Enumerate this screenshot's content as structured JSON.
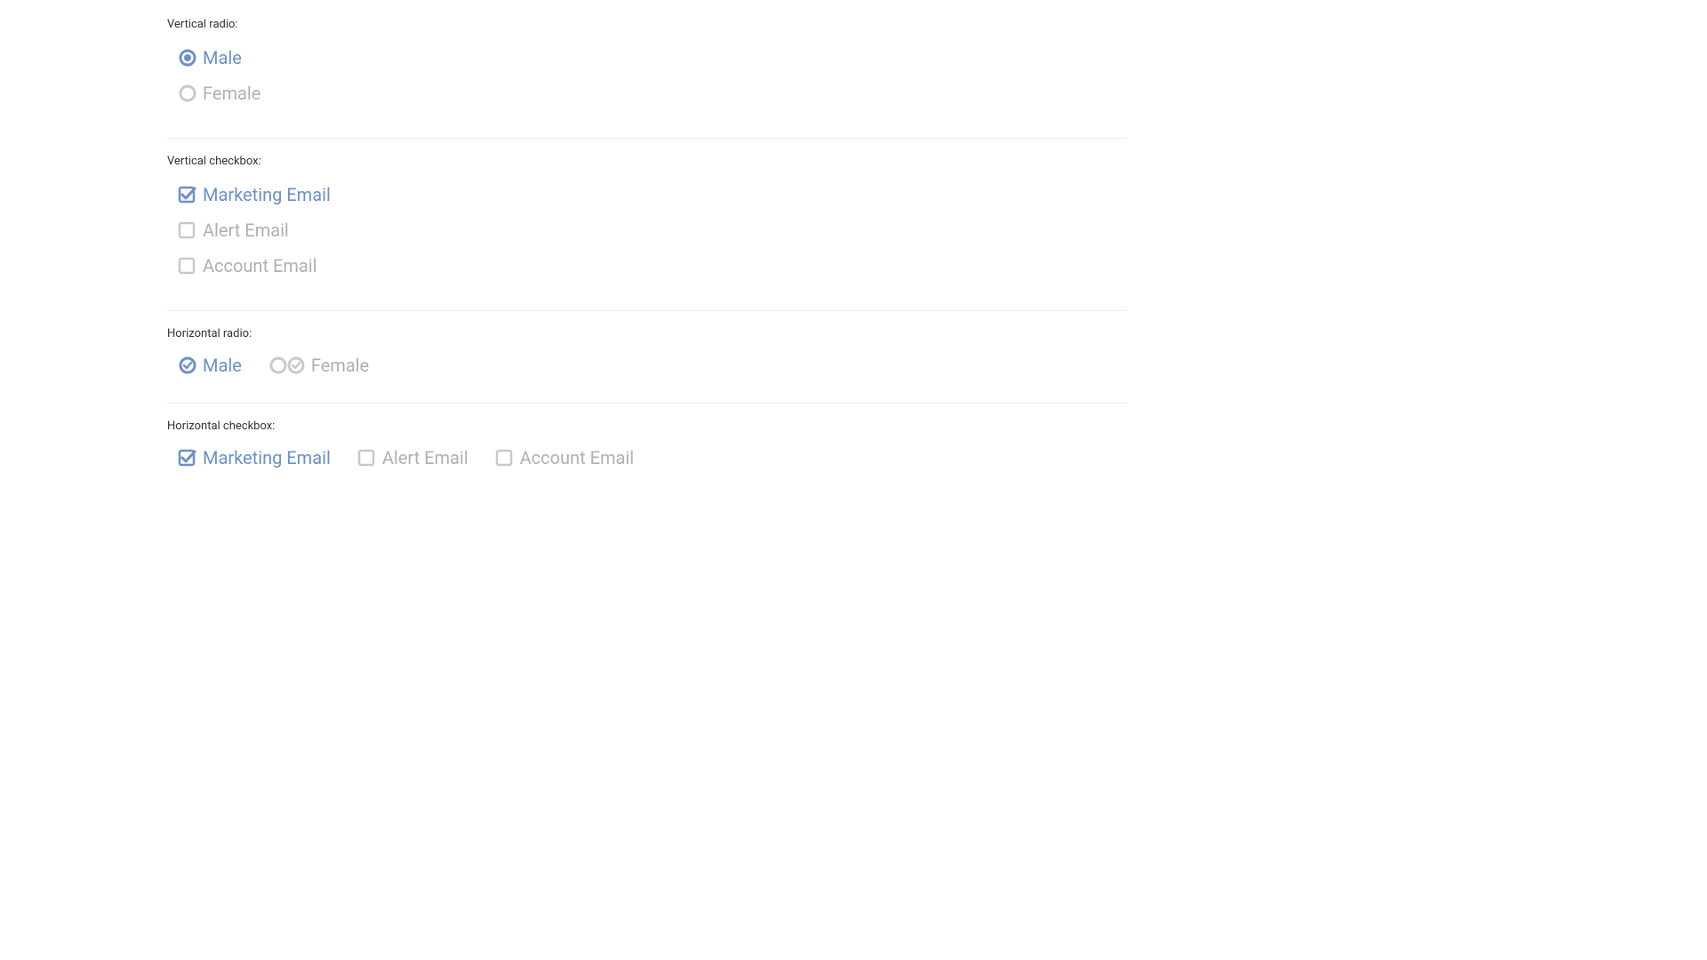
{
  "colors": {
    "selected": "#6b8fc9",
    "unselected": "#c9c9c9"
  },
  "sections": {
    "vertical_radio": {
      "label": "Vertical radio:",
      "options": [
        {
          "label": "Male",
          "selected": true
        },
        {
          "label": "Female",
          "selected": false
        }
      ]
    },
    "vertical_checkbox": {
      "label": "Vertical checkbox:",
      "options": [
        {
          "label": "Marketing Email",
          "selected": true
        },
        {
          "label": "Alert Email",
          "selected": false
        },
        {
          "label": "Account Email",
          "selected": false
        }
      ]
    },
    "horizontal_radio": {
      "label": "Horizontal radio:",
      "options": [
        {
          "label": "Male",
          "selected": true
        },
        {
          "label": "Female",
          "selected": false,
          "double_icon": true
        }
      ]
    },
    "horizontal_checkbox": {
      "label": "Horizontal checkbox:",
      "options": [
        {
          "label": "Marketing Email",
          "selected": true
        },
        {
          "label": "Alert Email",
          "selected": false
        },
        {
          "label": "Account Email",
          "selected": false
        }
      ]
    }
  }
}
